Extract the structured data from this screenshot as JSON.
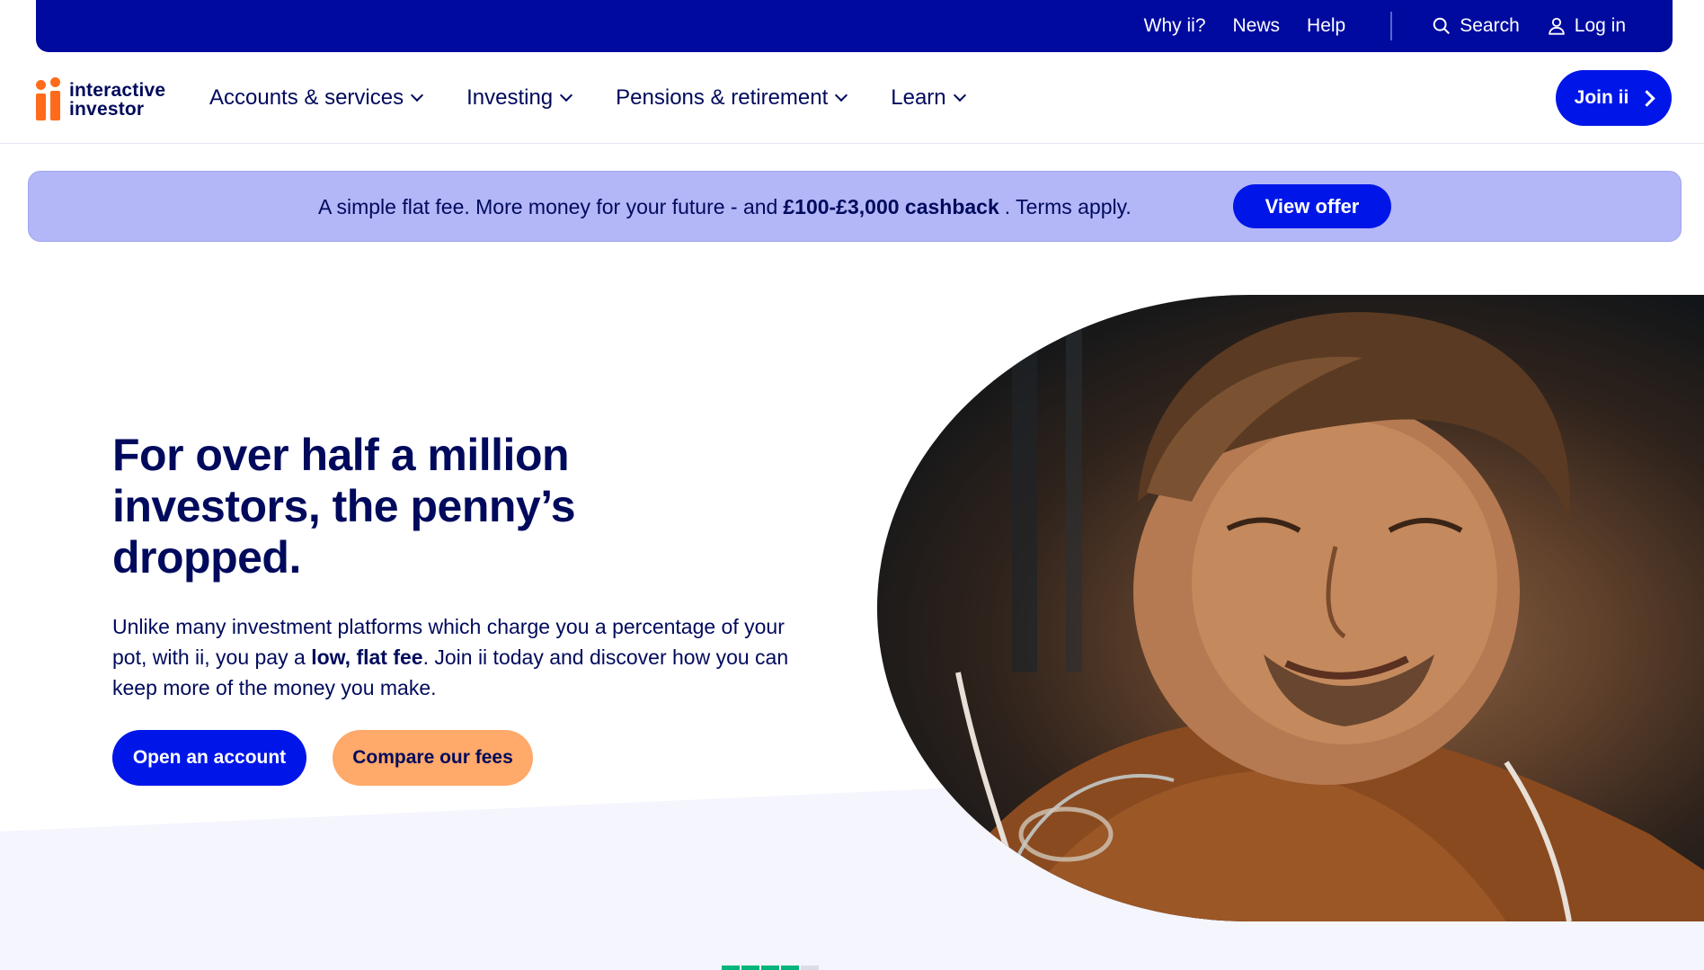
{
  "utility_nav": {
    "why": "Why ii?",
    "news": "News",
    "help": "Help",
    "search": "Search",
    "login": "Log in"
  },
  "brand": {
    "line1": "interactive",
    "line2": "investor"
  },
  "main_nav": {
    "items": [
      {
        "label": "Accounts & services"
      },
      {
        "label": "Investing"
      },
      {
        "label": "Pensions & retirement"
      },
      {
        "label": "Learn"
      }
    ],
    "join": "Join ii"
  },
  "promo": {
    "text_before": "A simple flat fee. More money for your future - and",
    "text_bold": "£100-£3,000 cashback",
    "text_after": ". Terms apply.",
    "button": "View offer"
  },
  "hero": {
    "title": "For over half a million investors, the penny’s dropped.",
    "body_before": "Unlike many investment platforms which charge you a percentage of your pot, with ii, you pay a",
    "body_bold": "low, flat fee",
    "body_after": ". Join ii today and discover how you can keep more of the money you make.",
    "primary_button": "Open an account",
    "secondary_button": "Compare our fees"
  },
  "colors": {
    "navy": "#000a5c",
    "utility_bg": "#000a9f",
    "primary_blue": "#0016e8",
    "promo_bg": "#b3b6f7",
    "accent_orange": "#ff6b1a",
    "secondary_button": "#ffa96a"
  },
  "icons": {
    "search": "search-icon",
    "login": "user-icon",
    "chevron": "chevron-down-icon",
    "join_arrow": "chevron-right-icon"
  }
}
